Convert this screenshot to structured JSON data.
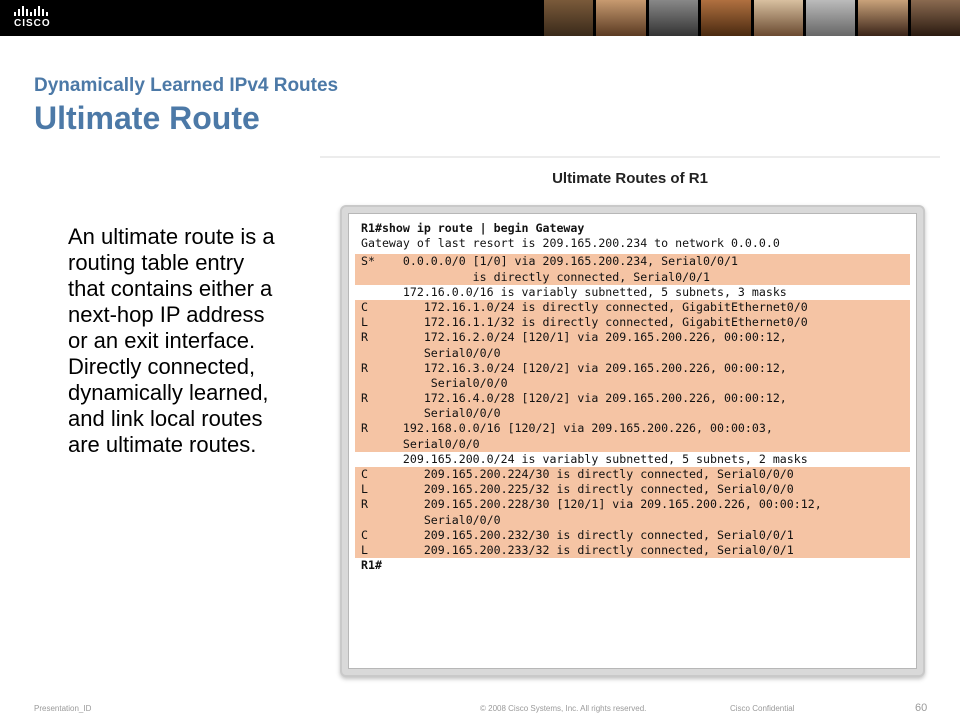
{
  "header": {
    "logo_text": "CISCO"
  },
  "slide": {
    "subtitle": "Dynamically Learned IPv4 Routes",
    "title": "Ultimate Route",
    "body": "An ultimate route is a routing table entry that contains either a next-hop IP address or an exit interface. Directly connected, dynamically learned, and link local routes are ultimate routes."
  },
  "figure": {
    "title": "Ultimate Routes of R1",
    "prompt": "R1#",
    "command": "show ip route | begin Gateway",
    "lines": {
      "l1": "Gateway of last resort is 209.165.200.234 to network 0.0.0.0",
      "l2": "S*    0.0.0.0/0 [1/0] via 209.165.200.234, Serial0/0/1",
      "l3": "                is directly connected, Serial0/0/1",
      "l4": "      172.16.0.0/16 is variably subnetted, 5 subnets, 3 masks",
      "l5": "C        172.16.1.0/24 is directly connected, GigabitEthernet0/0",
      "l6": "L        172.16.1.1/32 is directly connected, GigabitEthernet0/0",
      "l7": "R        172.16.2.0/24 [120/1] via 209.165.200.226, 00:00:12,",
      "l8": "         Serial0/0/0",
      "l9": "R        172.16.3.0/24 [120/2] via 209.165.200.226, 00:00:12,",
      "l10": "          Serial0/0/0",
      "l11": "R        172.16.4.0/28 [120/2] via 209.165.200.226, 00:00:12,",
      "l12": "         Serial0/0/0",
      "l13": "R     192.168.0.0/16 [120/2] via 209.165.200.226, 00:00:03,",
      "l14": "      Serial0/0/0",
      "l15": "      209.165.200.0/24 is variably subnetted, 5 subnets, 2 masks",
      "l16": "C        209.165.200.224/30 is directly connected, Serial0/0/0",
      "l17": "L        209.165.200.225/32 is directly connected, Serial0/0/0",
      "l18": "R        209.165.200.228/30 [120/1] via 209.165.200.226, 00:00:12,",
      "l19": "         Serial0/0/0",
      "l20": "C        209.165.200.232/30 is directly connected, Serial0/0/1",
      "l21": "L        209.165.200.233/32 is directly connected, Serial0/0/1",
      "l22": "R1#"
    }
  },
  "footer": {
    "presentation_id": "Presentation_ID",
    "copyright": "© 2008 Cisco Systems, Inc. All rights reserved.",
    "confidential": "Cisco Confidential",
    "page_number": "60"
  },
  "colors": {
    "title": "#4c79a7",
    "highlight": "#f5c4a4"
  }
}
